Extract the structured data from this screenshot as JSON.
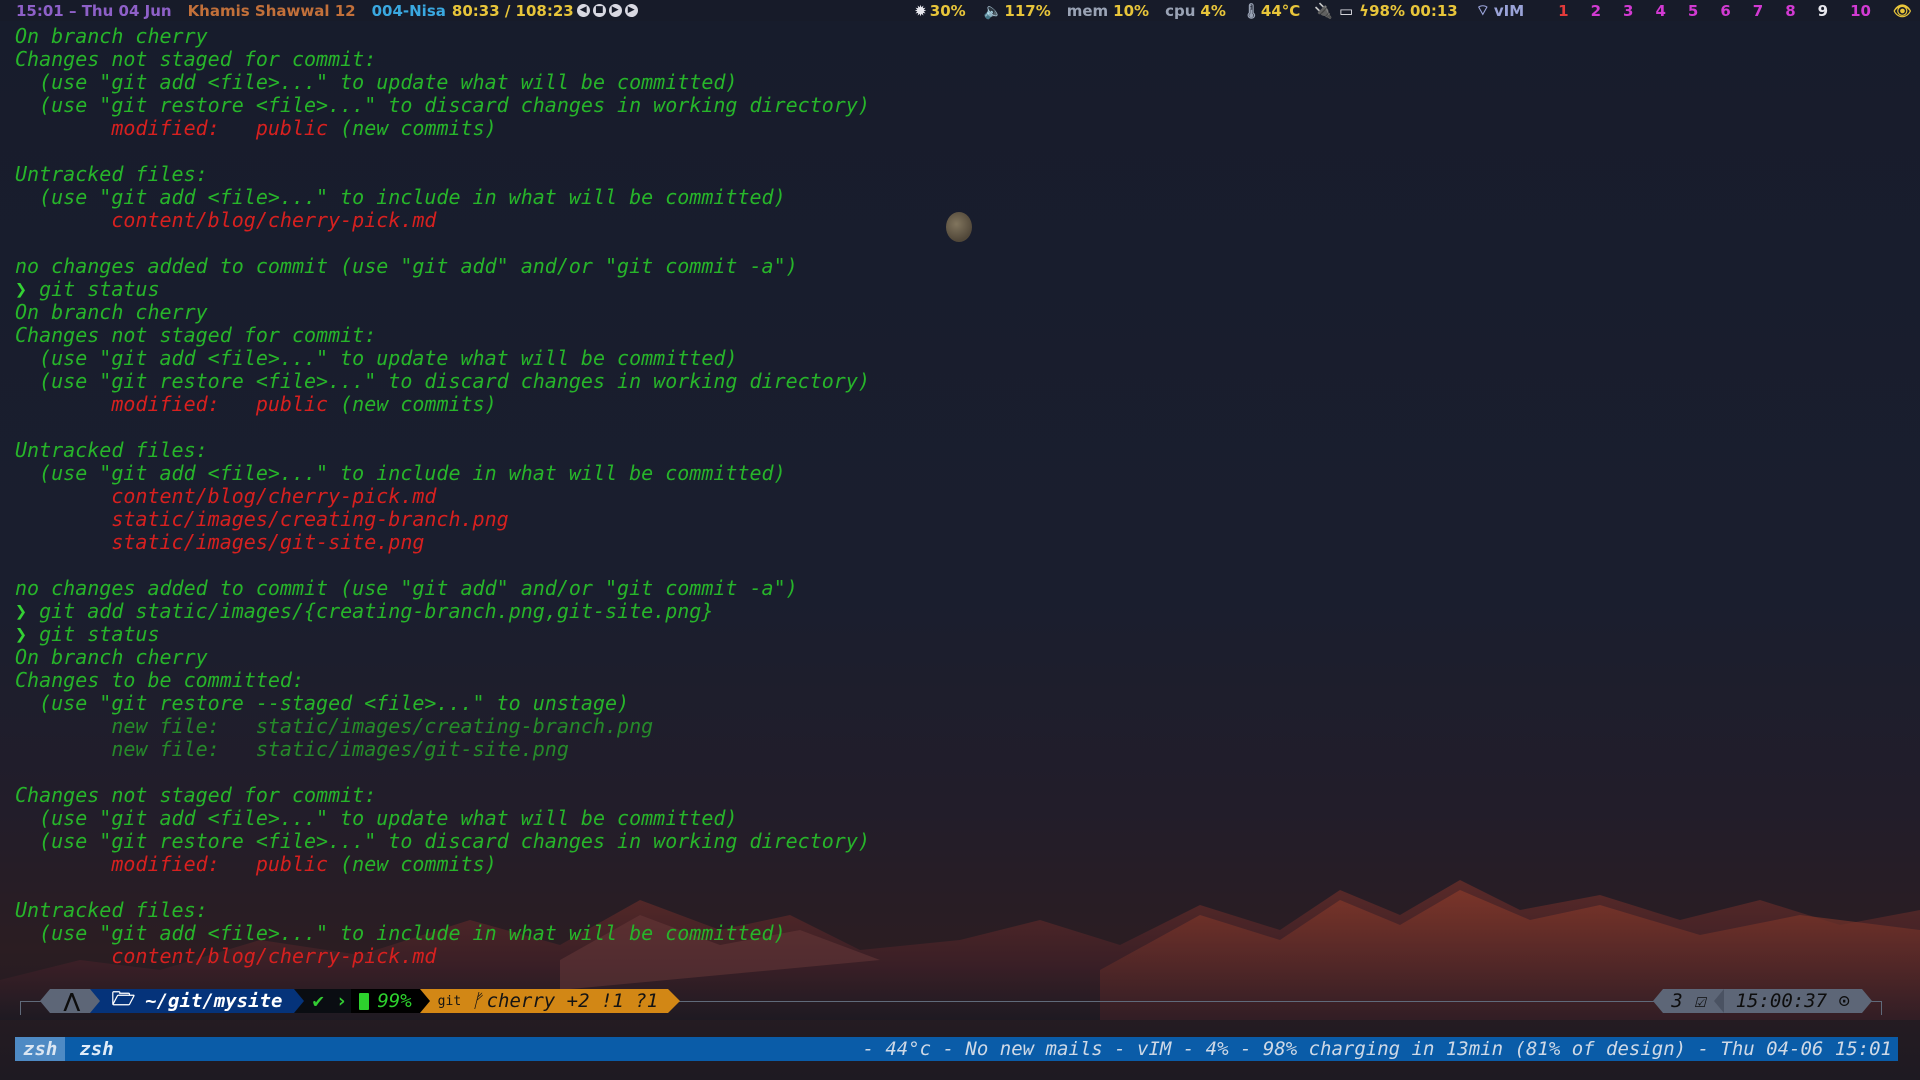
{
  "topbar": {
    "time": "15:01",
    "date": "Thu 04 Jun",
    "hijri_date": "Khamis Shawwal 12",
    "track": "004-Nisa",
    "track_time": "80:33 / 108:23",
    "brightness": "30%",
    "volume": "117%",
    "mem_label": "mem",
    "mem_value": "10%",
    "cpu_label": "cpu",
    "cpu_value": "4%",
    "temp": "44°C",
    "battery": "98%",
    "battery_time": "00:13",
    "network": "vIM",
    "workspaces": [
      "1",
      "2",
      "3",
      "4",
      "5",
      "6",
      "7",
      "8",
      "9",
      "10"
    ],
    "workspace_colors": [
      "#e23a3a",
      "#d23ad2",
      "#d23ad2",
      "#d23ad2",
      "#d23ad2",
      "#d23ad2",
      "#d23ad2",
      "#d23ad2",
      "#e8e8ee",
      "#d23ad2"
    ],
    "icons": [
      "brightness-icon",
      "volume-icon",
      "thermometer-icon",
      "plug-icon",
      "battery-icon",
      "bolt-icon",
      "wifi-icon",
      "eye-icon",
      "prev-icon",
      "play-icon",
      "stop-icon",
      "next-icon"
    ]
  },
  "terminal": {
    "lines": [
      [
        {
          "t": "On branch cherry",
          "c": "green"
        }
      ],
      [
        {
          "t": "Changes not staged for commit:",
          "c": "green"
        }
      ],
      [
        {
          "t": "  (use \"git add <file>...\" to update what will be committed)",
          "c": "green"
        }
      ],
      [
        {
          "t": "  (use \"git restore <file>...\" to discard changes in working directory)",
          "c": "green"
        }
      ],
      [
        {
          "t": "        modified:   public",
          "c": "red"
        },
        {
          "t": " (new commits)",
          "c": "green"
        }
      ],
      [],
      [
        {
          "t": "Untracked files:",
          "c": "green"
        }
      ],
      [
        {
          "t": "  (use \"git add <file>...\" to include in what will be committed)",
          "c": "green"
        }
      ],
      [
        {
          "t": "        content/blog/cherry-pick.md",
          "c": "red"
        }
      ],
      [],
      [
        {
          "t": "no changes added to commit (use \"git add\" and/or \"git commit -a\")",
          "c": "green"
        }
      ],
      [
        {
          "t": "❯",
          "c": "prompt"
        },
        {
          "t": " git",
          "c": "cmd"
        },
        {
          "t": " status",
          "c": "green"
        }
      ],
      [
        {
          "t": "On branch cherry",
          "c": "green"
        }
      ],
      [
        {
          "t": "Changes not staged for commit:",
          "c": "green"
        }
      ],
      [
        {
          "t": "  (use \"git add <file>...\" to update what will be committed)",
          "c": "green"
        }
      ],
      [
        {
          "t": "  (use \"git restore <file>...\" to discard changes in working directory)",
          "c": "green"
        }
      ],
      [
        {
          "t": "        modified:   public",
          "c": "red"
        },
        {
          "t": " (new commits)",
          "c": "green"
        }
      ],
      [],
      [
        {
          "t": "Untracked files:",
          "c": "green"
        }
      ],
      [
        {
          "t": "  (use \"git add <file>...\" to include in what will be committed)",
          "c": "green"
        }
      ],
      [
        {
          "t": "        content/blog/cherry-pick.md",
          "c": "red"
        }
      ],
      [
        {
          "t": "        static/images/creating-branch.png",
          "c": "red"
        }
      ],
      [
        {
          "t": "        static/images/git-site.png",
          "c": "red"
        }
      ],
      [],
      [
        {
          "t": "no changes added to commit (use \"git add\" and/or \"git commit -a\")",
          "c": "green"
        }
      ],
      [
        {
          "t": "❯",
          "c": "prompt"
        },
        {
          "t": " git",
          "c": "cmd"
        },
        {
          "t": " add static/images/{creating-branch.png,git-site.png}",
          "c": "green"
        }
      ],
      [
        {
          "t": "❯",
          "c": "prompt"
        },
        {
          "t": " git",
          "c": "cmd"
        },
        {
          "t": " status",
          "c": "green"
        }
      ],
      [
        {
          "t": "On branch cherry",
          "c": "green"
        }
      ],
      [
        {
          "t": "Changes to be committed:",
          "c": "green"
        }
      ],
      [
        {
          "t": "  (use \"git restore --staged <file>...\" to unstage)",
          "c": "green"
        }
      ],
      [
        {
          "t": "        new file:   static/images/creating-branch.png",
          "c": "dgreen"
        }
      ],
      [
        {
          "t": "        new file:   static/images/git-site.png",
          "c": "dgreen"
        }
      ],
      [],
      [
        {
          "t": "Changes not staged for commit:",
          "c": "green"
        }
      ],
      [
        {
          "t": "  (use \"git add <file>...\" to update what will be committed)",
          "c": "green"
        }
      ],
      [
        {
          "t": "  (use \"git restore <file>...\" to discard changes in working directory)",
          "c": "green"
        }
      ],
      [
        {
          "t": "        modified:   public",
          "c": "red"
        },
        {
          "t": " (new commits)",
          "c": "green"
        }
      ],
      [],
      [
        {
          "t": "Untracked files:",
          "c": "green"
        }
      ],
      [
        {
          "t": "  (use \"git add <file>...\" to include in what will be committed)",
          "c": "green"
        }
      ],
      [
        {
          "t": "        content/blog/cherry-pick.md",
          "c": "red"
        }
      ]
    ]
  },
  "prompt": {
    "os_icon": "⋀",
    "dir_icon": "🗁",
    "dir": "~/git/mysite",
    "status_ok": "✔",
    "battery": "99%",
    "git_label": "git",
    "branch_icon": "ᚠ",
    "branch": "cherry +2 !1 ?1",
    "jobs": "3 ☑",
    "clock": "15:00:37 ⊙"
  },
  "tmux": {
    "session": "zsh",
    "window": "zsh",
    "status": "- 44°c - No new mails - vIM - 4% - 98% charging in 13min (81% of design) - Thu 04-06 15:01"
  },
  "colors": {
    "term_green": "#27b52a",
    "term_red": "#d7201f",
    "term_dgreen": "#268a2a",
    "tmux_bar": "#0a5ca8",
    "prompt_dir": "#05337a",
    "prompt_git": "#d28715"
  }
}
